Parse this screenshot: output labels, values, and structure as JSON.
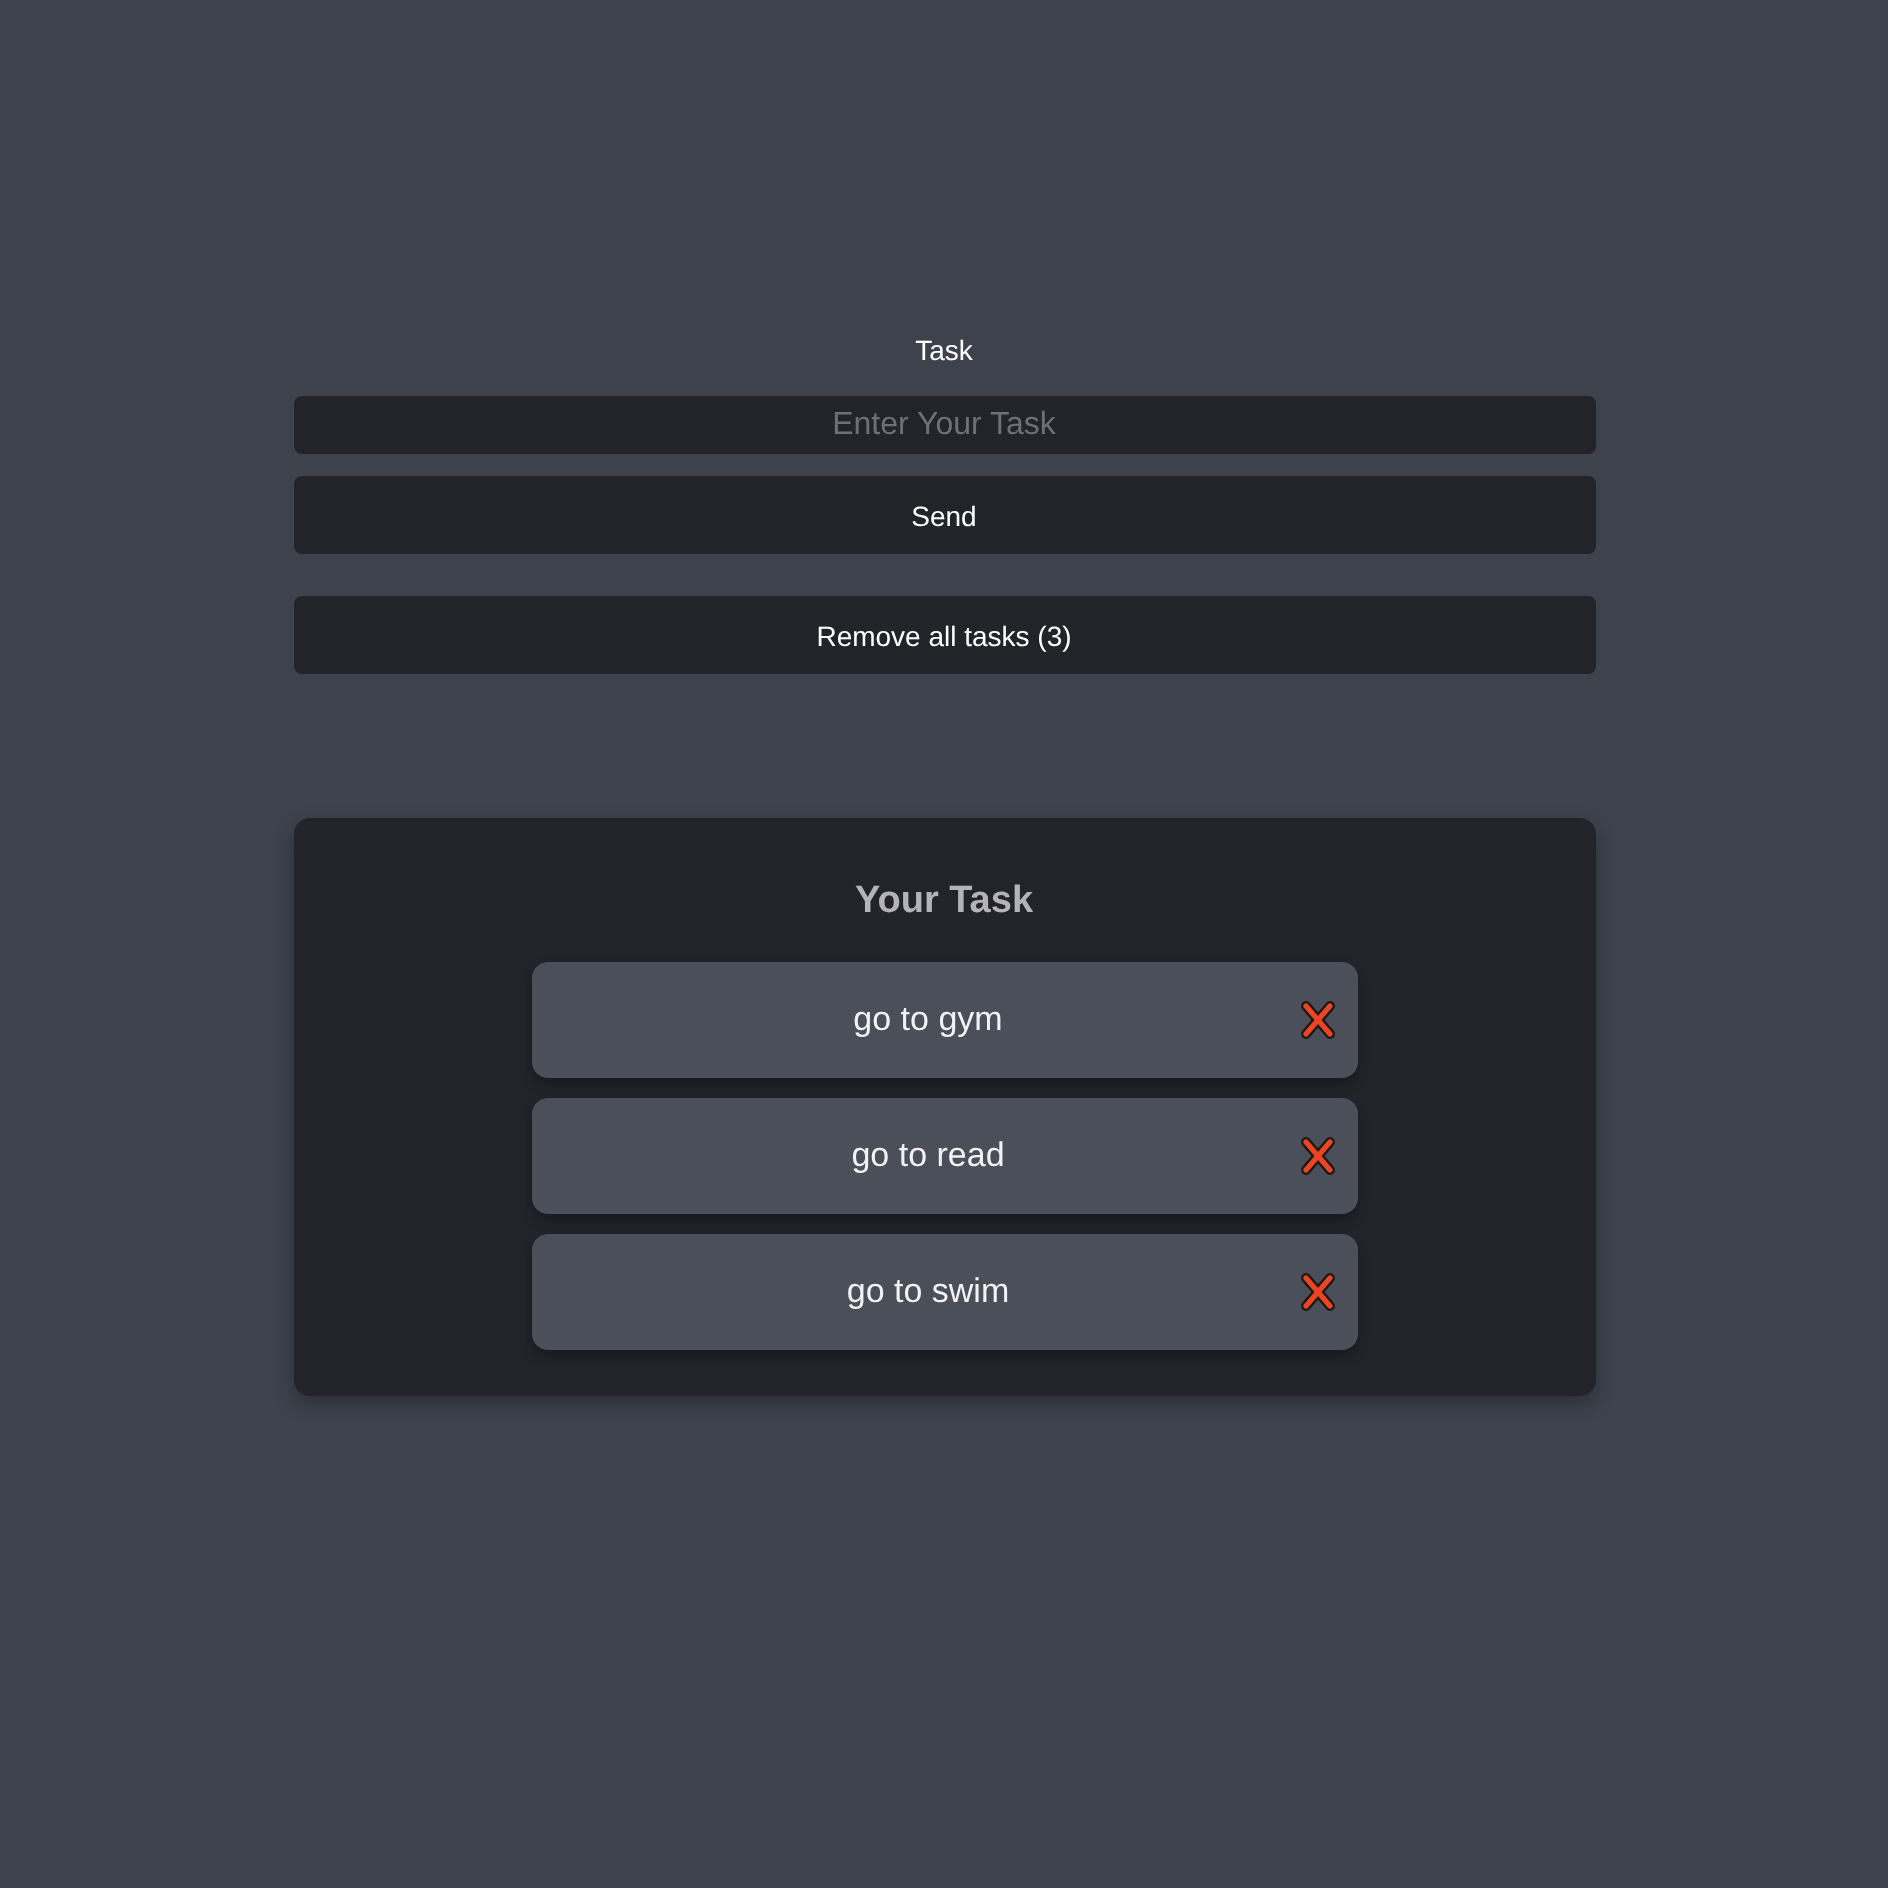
{
  "form": {
    "label": "Task",
    "input": {
      "placeholder": "Enter Your Task"
    },
    "send_button": "Send",
    "remove_all_button": "Remove all tasks (3)"
  },
  "task_list": {
    "title": "Your Task",
    "tasks": [
      {
        "text": "go to gym"
      },
      {
        "text": "go to read"
      },
      {
        "text": "go to swim"
      }
    ]
  }
}
